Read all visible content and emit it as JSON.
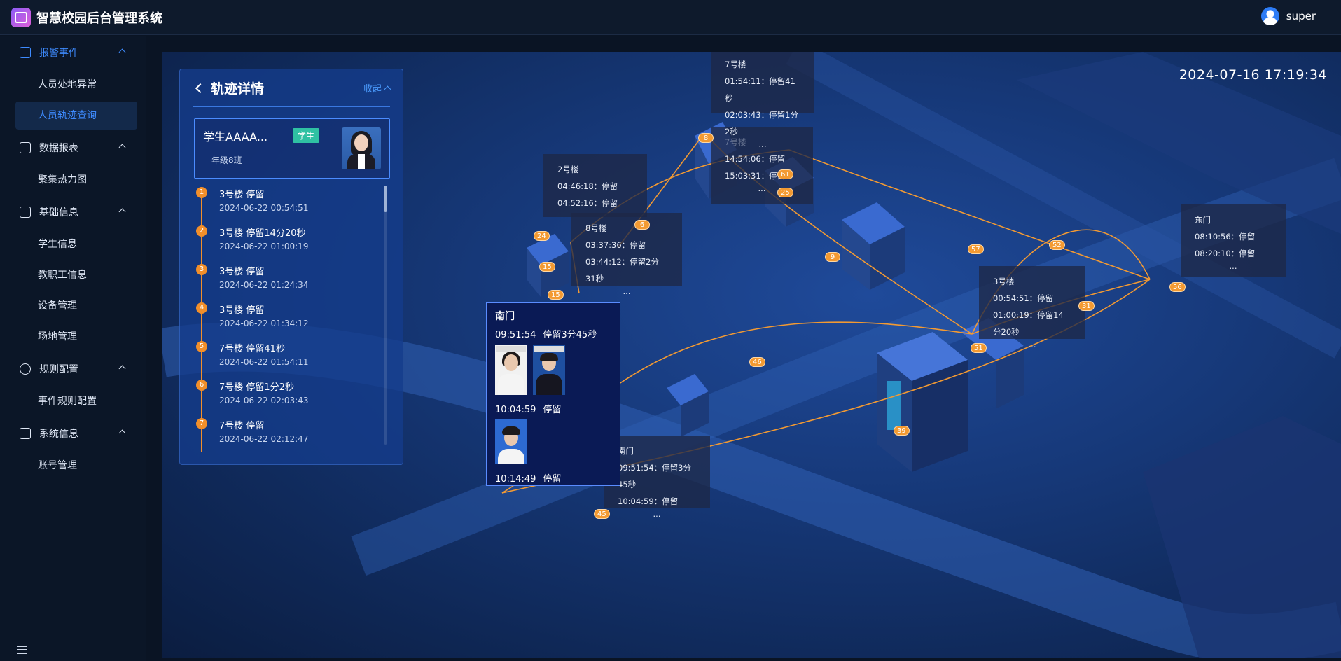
{
  "app": {
    "title": "智慧校园后台管理系统",
    "user": "super"
  },
  "sidebar": {
    "groups": [
      {
        "label": "报警事件",
        "icon": "alarm-icon",
        "items": [
          "人员处地异常",
          "人员轨迹查询"
        ]
      },
      {
        "label": "数据报表",
        "icon": "report-icon",
        "items": [
          "聚集热力图"
        ]
      },
      {
        "label": "基础信息",
        "icon": "info-icon",
        "items": [
          "学生信息",
          "教职工信息",
          "设备管理",
          "场地管理"
        ]
      },
      {
        "label": "规则配置",
        "icon": "gear-icon",
        "items": [
          "事件规则配置"
        ]
      },
      {
        "label": "系统信息",
        "icon": "monitor-icon",
        "items": [
          "账号管理"
        ]
      }
    ],
    "selected": "人员轨迹查询"
  },
  "map": {
    "clock": "2024-07-16 17:19:34"
  },
  "panel": {
    "title": "轨迹详情",
    "collapse_label": "收起",
    "student": {
      "name": "学生AAAA...",
      "tag": "学生",
      "class": "一年级8班"
    },
    "tracks": [
      {
        "num": "1",
        "title": "3号楼 停留",
        "time": "2024-06-22 00:54:51"
      },
      {
        "num": "2",
        "title": "3号楼 停留14分20秒",
        "time": "2024-06-22 01:00:19"
      },
      {
        "num": "3",
        "title": "3号楼 停留",
        "time": "2024-06-22 01:24:34"
      },
      {
        "num": "4",
        "title": "3号楼 停留",
        "time": "2024-06-22 01:34:12"
      },
      {
        "num": "5",
        "title": "7号楼 停留41秒",
        "time": "2024-06-22 01:54:11"
      },
      {
        "num": "6",
        "title": "7号楼 停留1分2秒",
        "time": "2024-06-22 02:03:43"
      },
      {
        "num": "7",
        "title": "7号楼 停留",
        "time": "2024-06-22 02:12:47"
      }
    ]
  },
  "tooltips": {
    "b7": {
      "title": "7号楼",
      "l1": "01:54:11：停留41秒",
      "l2": "02:03:43：停留1分2秒",
      "more": "..."
    },
    "b7b": {
      "title": "7号楼",
      "l1": "14:54:06：停留",
      "l2": "15:03:31：停留",
      "more": "..."
    },
    "b2": {
      "title": "2号楼",
      "l1": "04:46:18：停留",
      "l2": "04:52:16：停留",
      "more": "..."
    },
    "b8": {
      "title": "8号楼",
      "l1": "03:37:36：停留",
      "l2": "03:44:12：停留2分31秒",
      "more": "..."
    },
    "east": {
      "title": "东门",
      "l1": "08:10:56：停留",
      "l2": "08:20:10：停留",
      "more": "..."
    },
    "b3": {
      "title": "3号楼",
      "l1": "00:54:51：停留",
      "l2": "01:00:19：停留14分20秒",
      "more": "..."
    },
    "south": {
      "title": "南门",
      "l1": "09:51:54：停留3分45秒",
      "l2": "10:04:59：停留",
      "more": "..."
    }
  },
  "popup": {
    "title": "南门",
    "r1_time": "09:51:54",
    "r1_text": "停留3分45秒",
    "r2_time": "10:04:59",
    "r2_text": "停留",
    "r3_time": "10:14:49",
    "r3_text": "停留"
  },
  "markers": [
    "8",
    "61",
    "25",
    "24",
    "15",
    "15",
    "6",
    "57",
    "52",
    "9",
    "56",
    "31",
    "51",
    "46",
    "39",
    "45"
  ],
  "colors": {
    "accent": "#3e8bff",
    "route": "#f39a32",
    "tag": "#2fc1a3"
  }
}
